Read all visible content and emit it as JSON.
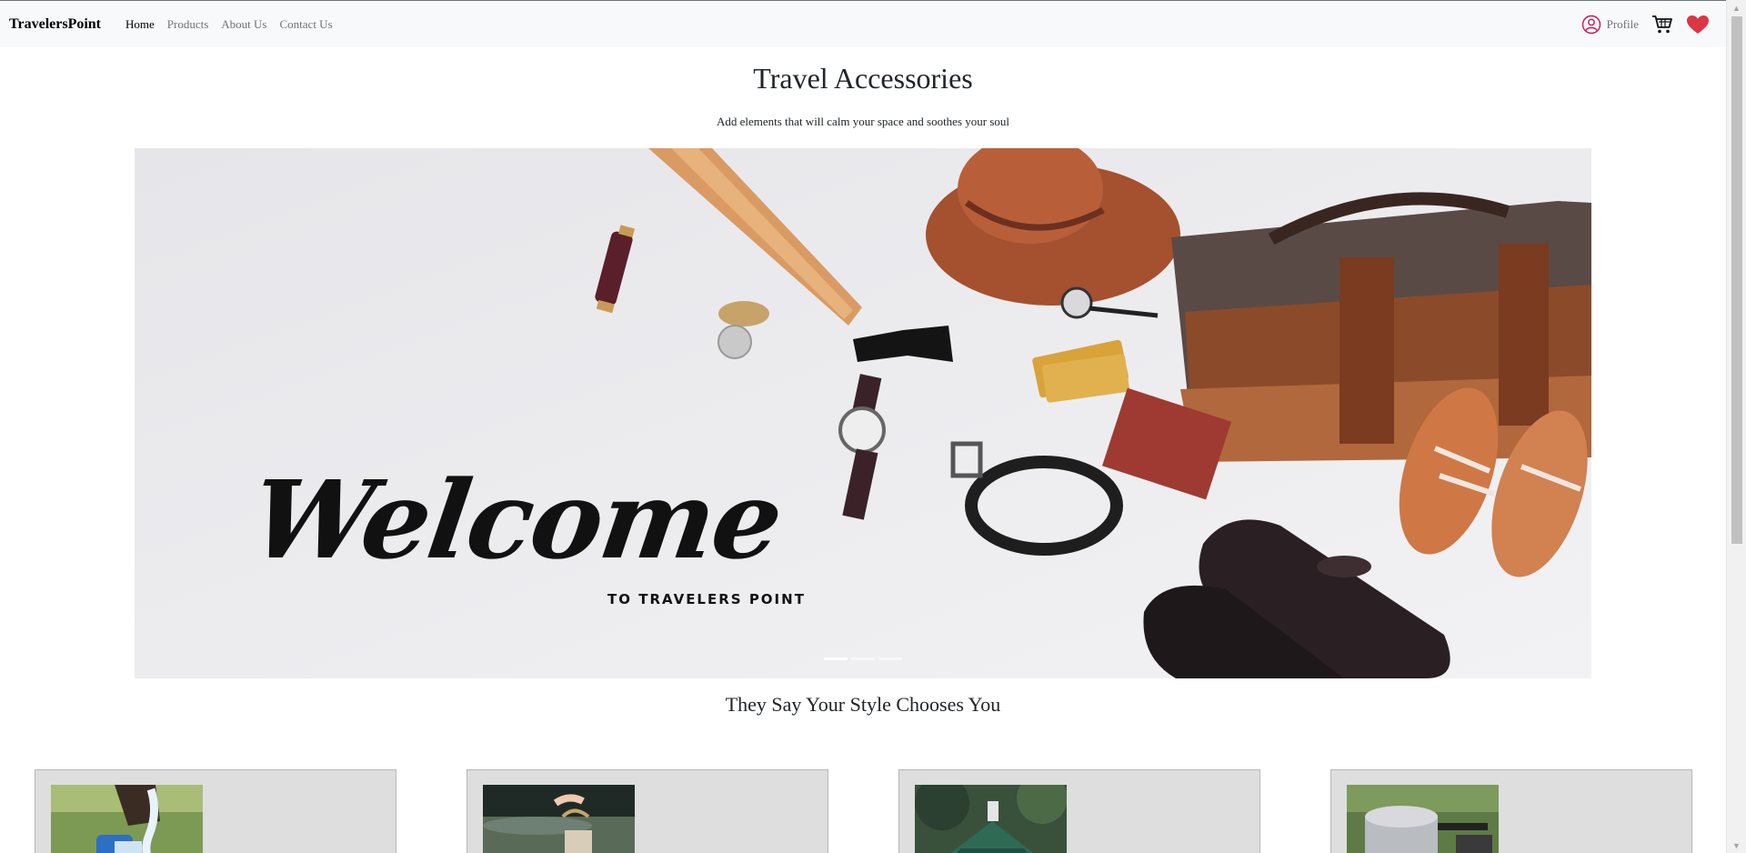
{
  "navbar": {
    "brand": "TravelersPoint",
    "links": [
      {
        "label": "Home",
        "active": true
      },
      {
        "label": "Products",
        "active": false
      },
      {
        "label": "About Us",
        "active": false
      },
      {
        "label": "Contact Us",
        "active": false
      }
    ],
    "profile_label": "Profile",
    "profile_icon": "user-circle-icon",
    "cart_icon": "cart-icon",
    "wishlist_icon": "heart-icon"
  },
  "hero": {
    "title": "Travel Accessories",
    "subtitle": "Add elements that will calm your space and soothes your soul"
  },
  "carousel": {
    "slide_heading": "Welcome",
    "slide_subheading": "TO TRAVELERS POINT",
    "slide_count": 3,
    "active_index": 0
  },
  "style_section": {
    "heading": "They Say Your Style Chooses You",
    "cards": [
      {
        "image_subject": "water-bottle-photo"
      },
      {
        "image_subject": "lantern-photo"
      },
      {
        "image_subject": "tent-photo"
      },
      {
        "image_subject": "cooking-pot-photo"
      }
    ]
  },
  "colors": {
    "navbar_bg": "#f8f9fa",
    "heart": "#dc3545",
    "profile_icon": "#c2185b",
    "card_bg": "#dedede"
  }
}
